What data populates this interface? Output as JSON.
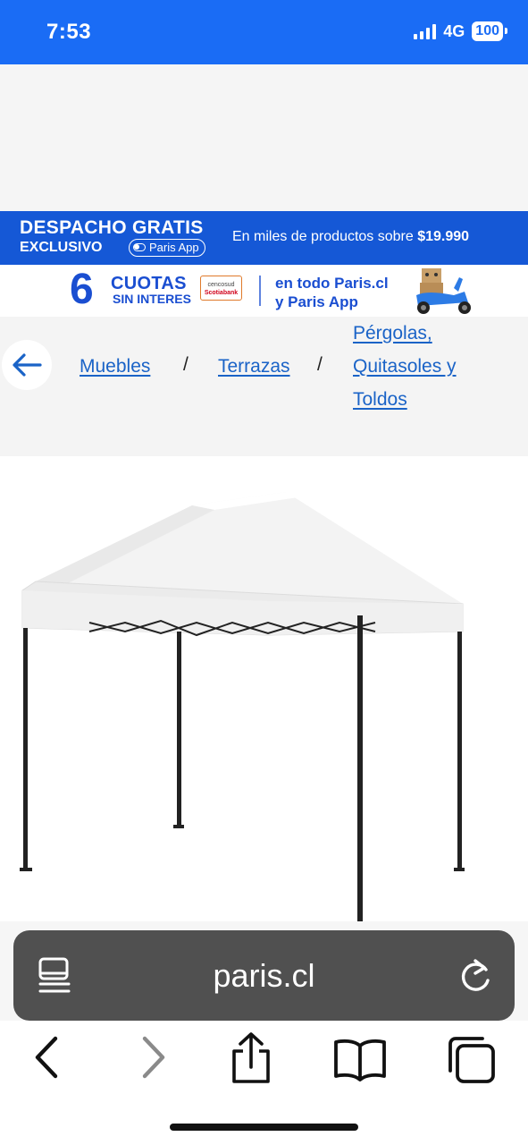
{
  "status_bar": {
    "time": "7:53",
    "network": "4G",
    "battery": "100"
  },
  "banner_despacho": {
    "title": "DESPACHO GRATIS",
    "subtitle": "EXCLUSIVO",
    "app_pill": "Paris App",
    "message_prefix": "En miles de productos sobre ",
    "message_amount": "$19.990"
  },
  "banner_cuotas": {
    "number": "6",
    "cuotas": "CUOTAS",
    "sin_interes": "SIN INTERES",
    "bank_top": "cencosud",
    "bank_bottom": "Scotiabank",
    "line1": "en todo Paris.cl",
    "line2": "y Paris App"
  },
  "breadcrumb": {
    "items": [
      {
        "label": "Muebles"
      },
      {
        "label": "Terrazas"
      },
      {
        "label_line1": "Pérgolas,",
        "label_line2": "Quitasoles y",
        "label_line3": "Toldos"
      }
    ],
    "separator": "/"
  },
  "browser": {
    "url": "paris.cl"
  },
  "icons": {
    "back": "arrow-left-icon",
    "reader": "reader-mode-icon",
    "reload": "reload-icon",
    "toolbar": [
      "back-chevron-icon",
      "forward-chevron-icon",
      "share-icon",
      "bookmarks-icon",
      "tabs-icon"
    ]
  },
  "colors": {
    "brand_blue": "#1a6cf5",
    "banner_blue": "#1558d6",
    "link_blue": "#1a63c7",
    "url_bar": "#505050"
  }
}
